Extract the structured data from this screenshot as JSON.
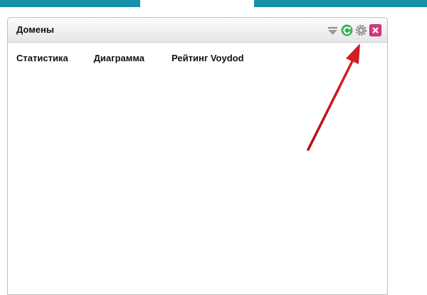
{
  "widget": {
    "title": "Домены",
    "controls": [
      {
        "icon": "collapse-icon",
        "color": "#8a8a8a"
      },
      {
        "icon": "refresh-icon",
        "color": "#3fae56"
      },
      {
        "icon": "gear-icon",
        "color": "#8c8c8c"
      },
      {
        "icon": "close-icon",
        "color": "#d6377b"
      }
    ],
    "tabs": [
      {
        "label": "Статистика"
      },
      {
        "label": "Диаграмма"
      },
      {
        "label": "Рейтинг Voydod"
      }
    ]
  },
  "colors": {
    "topbar": "#1990a8",
    "annotation_arrow": "#b50e16"
  }
}
